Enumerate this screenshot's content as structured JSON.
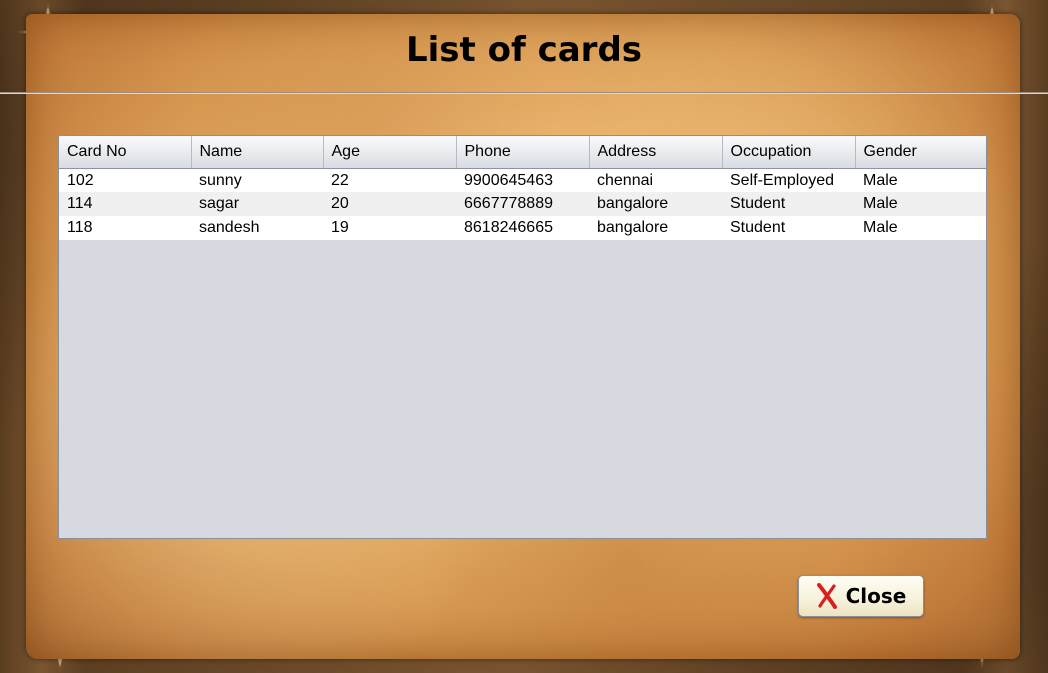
{
  "window": {
    "title": "List of cards"
  },
  "table": {
    "columns": [
      "Card No",
      "Name",
      "Age",
      "Phone",
      "Address",
      "Occupation",
      "Gender"
    ],
    "rows": [
      [
        "102",
        "sunny",
        "22",
        "9900645463",
        "chennai",
        "Self-Employed",
        "Male"
      ],
      [
        "114",
        "sagar",
        "20",
        "6667778889",
        "bangalore",
        "Student",
        "Male"
      ],
      [
        "118",
        "sandesh",
        "19",
        "8618246665",
        "bangalore",
        "Student",
        "Male"
      ]
    ]
  },
  "actions": {
    "close_label": "Close",
    "close_icon": "close-x-icon"
  },
  "colors": {
    "close_icon": "#d81f1f",
    "table_empty_area": "#d6d9df"
  }
}
